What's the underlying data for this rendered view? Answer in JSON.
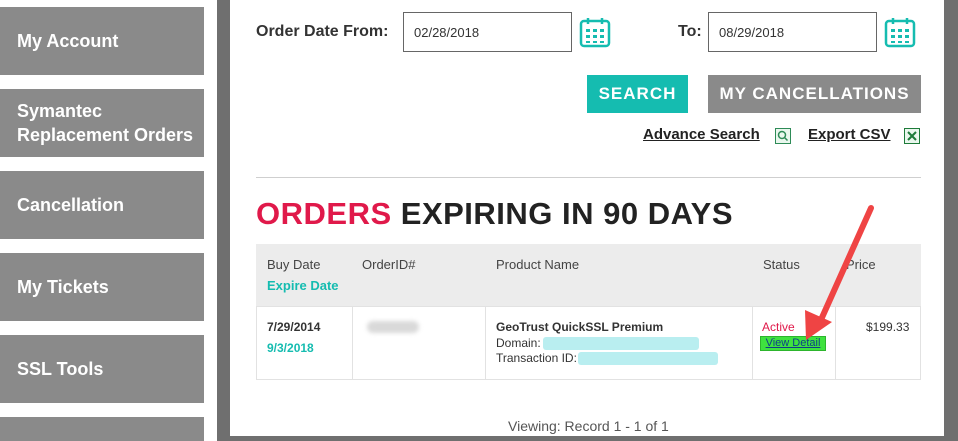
{
  "sidebar": {
    "items": [
      {
        "label": "My Account"
      },
      {
        "label_line1": "Symantec",
        "label_line2": "Replacement Orders"
      },
      {
        "label": "Cancellation"
      },
      {
        "label": "My Tickets"
      },
      {
        "label": "SSL Tools"
      }
    ]
  },
  "filters": {
    "from_label": "Order Date From:",
    "from_value": "02/28/2018",
    "to_label": "To:",
    "to_value": "08/29/2018"
  },
  "buttons": {
    "search": "SEARCH",
    "my_cancellations": "MY CANCELLATIONS"
  },
  "links": {
    "advance_search": "Advance Search",
    "export_csv": "Export CSV"
  },
  "heading": {
    "accent": "ORDERS",
    "rest": "EXPIRING IN 90 DAYS"
  },
  "table": {
    "headers": {
      "buy_date": "Buy Date",
      "expire_date": "Expire Date",
      "order_id": "OrderID#",
      "product_name": "Product Name",
      "status": "Status",
      "price": "Price"
    },
    "rows": [
      {
        "buy_date": "7/29/2014",
        "expire_date": "9/3/2018",
        "product": "GeoTrust QuickSSL Premium",
        "domain_label": "Domain:",
        "transaction_label": "Transaction ID:",
        "status": "Active",
        "view_detail": "View Detail",
        "price": "$199.33"
      }
    ]
  },
  "footer": {
    "viewing": "Viewing: Record 1 - 1 of 1"
  },
  "colors": {
    "accent_teal": "#15bcb0",
    "accent_red": "#e0194a",
    "sidebar_gray": "#8a8a8a",
    "highlight_green": "#3fe23f"
  }
}
